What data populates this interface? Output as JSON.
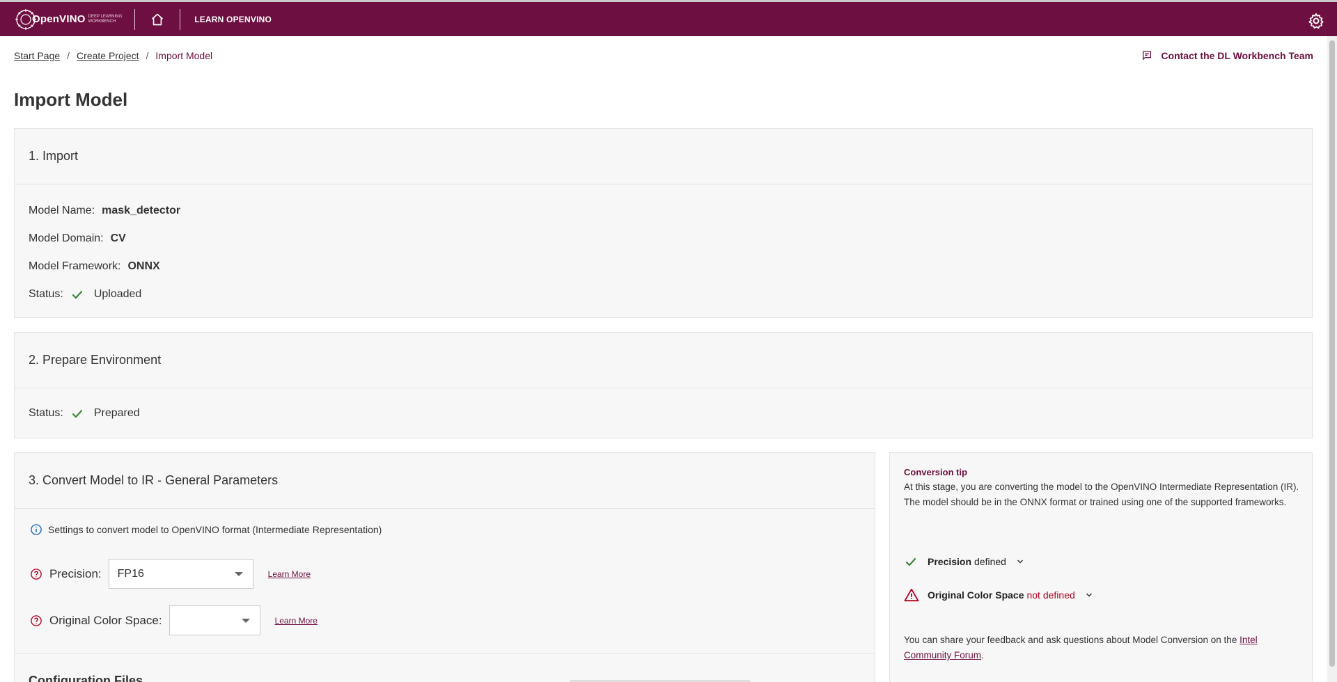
{
  "header": {
    "logo_text": "OpenVINO",
    "logo_subtitle_1": "Deep Learning",
    "logo_subtitle_2": "Workbench",
    "learn_label": "LEARN OPENVINO"
  },
  "breadcrumb": {
    "items": [
      "Start Page",
      "Create Project"
    ],
    "separator": "/",
    "current": "Import Model"
  },
  "contact_label": "Contact the DL Workbench Team",
  "page_title": "Import Model",
  "import_section": {
    "title": "1. Import",
    "model_name_label": "Model Name:",
    "model_name": "mask_detector",
    "domain_label": "Model Domain:",
    "domain": "CV",
    "framework_label": "Model Framework:",
    "framework": "ONNX",
    "status_label": "Status:",
    "status": "Uploaded"
  },
  "environment_section": {
    "title": "2. Prepare Environment",
    "status_label": "Status:",
    "status": "Prepared"
  },
  "convert_section": {
    "title": "3. Convert Model to IR - General Parameters",
    "info_text": "Settings to convert model to OpenVINO format (Intermediate Representation)",
    "precision_label": "Precision:",
    "precision_value": "FP16",
    "color_space_label": "Original Color Space:",
    "color_space_value": "",
    "learn_more": "Learn More",
    "config_title": "Configuration Files"
  },
  "tip": {
    "title": "Conversion tip",
    "text": "At this stage, you are converting the model to the OpenVINO Intermediate Representation (IR). The model should be in the ONNX format or trained using one of the supported frameworks.",
    "precision_name": "Precision",
    "precision_state": "defined",
    "color_space_name": "Original Color Space",
    "color_space_state": "not defined",
    "feedback_text": "You can share your feedback and ask questions about Model Conversion on the ",
    "feedback_link": "Intel Community Forum",
    "feedback_end": "."
  },
  "colors": {
    "brand": "#6d0f40",
    "success": "#2e7d32",
    "error": "#b00020",
    "info": "#1565c0"
  }
}
